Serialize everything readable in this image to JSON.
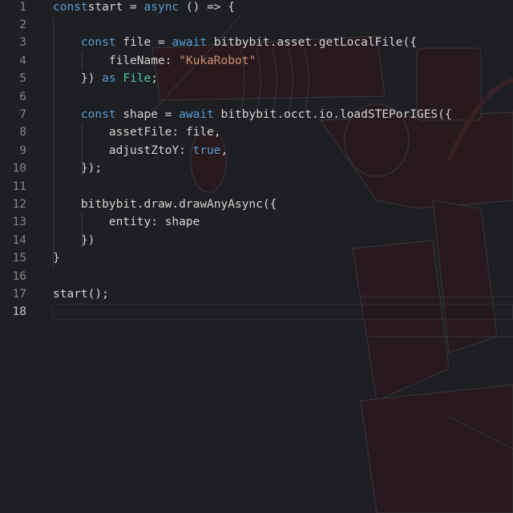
{
  "editor": {
    "active_line": 18,
    "lines": [
      {
        "n": "1",
        "tokens": [
          [
            "kw",
            "const"
          ],
          [
            "",
            "start = "
          ],
          [
            "kw",
            "async"
          ],
          [
            "",
            " () => {"
          ]
        ]
      },
      {
        "n": "2",
        "tokens": []
      },
      {
        "n": "3",
        "tokens": [
          [
            "",
            "    "
          ],
          [
            "kw",
            "const"
          ],
          [
            "",
            " file = "
          ],
          [
            "kw",
            "await"
          ],
          [
            "",
            " bitbybit.asset.getLocalFile({"
          ]
        ]
      },
      {
        "n": "4",
        "tokens": [
          [
            "",
            "        fileName: "
          ],
          [
            "str",
            "\"KukaRobot\""
          ]
        ]
      },
      {
        "n": "5",
        "tokens": [
          [
            "",
            "    }) "
          ],
          [
            "kw",
            "as"
          ],
          [
            "",
            " "
          ],
          [
            "type",
            "File"
          ],
          [
            "",
            ";"
          ]
        ]
      },
      {
        "n": "6",
        "tokens": []
      },
      {
        "n": "7",
        "tokens": [
          [
            "",
            "    "
          ],
          [
            "kw",
            "const"
          ],
          [
            "",
            " shape = "
          ],
          [
            "kw",
            "await"
          ],
          [
            "",
            " bitbybit.occt.io.loadSTEPorIGES({"
          ]
        ]
      },
      {
        "n": "8",
        "tokens": [
          [
            "",
            "        assetFile: file,"
          ]
        ]
      },
      {
        "n": "9",
        "tokens": [
          [
            "",
            "        adjustZtoY: "
          ],
          [
            "kw",
            "true"
          ],
          [
            "",
            ","
          ]
        ]
      },
      {
        "n": "10",
        "tokens": [
          [
            "",
            "    });"
          ]
        ]
      },
      {
        "n": "11",
        "tokens": []
      },
      {
        "n": "12",
        "tokens": [
          [
            "",
            "    bitbybit.draw.drawAnyAsync({"
          ]
        ]
      },
      {
        "n": "13",
        "tokens": [
          [
            "",
            "        entity: shape"
          ]
        ]
      },
      {
        "n": "14",
        "tokens": [
          [
            "",
            "    })"
          ]
        ]
      },
      {
        "n": "15",
        "tokens": [
          [
            "",
            "}"
          ]
        ]
      },
      {
        "n": "16",
        "tokens": []
      },
      {
        "n": "17",
        "tokens": [
          [
            "",
            "start();"
          ]
        ]
      },
      {
        "n": "18",
        "tokens": []
      }
    ]
  },
  "colors": {
    "background": "#1e1f22",
    "keyword": "#569cd6",
    "string": "#ce9178",
    "type": "#4ec9b0",
    "text": "#d4d4d4"
  }
}
